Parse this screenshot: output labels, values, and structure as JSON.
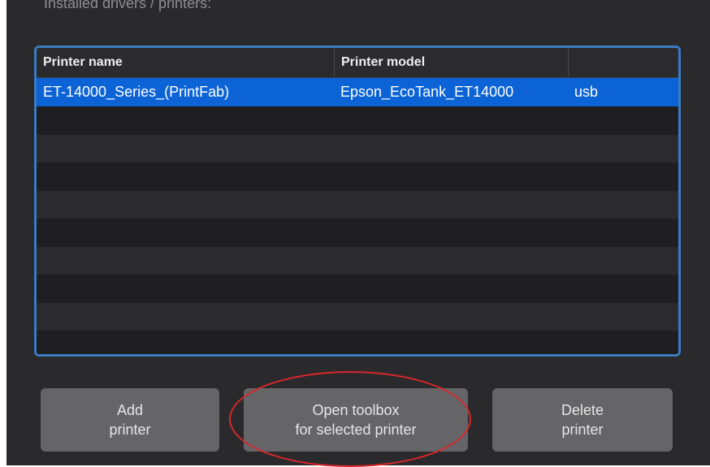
{
  "header": {
    "partial_text": "Installed drivers / printers:"
  },
  "table": {
    "columns": [
      "Printer name",
      "Printer model",
      ""
    ],
    "rows": [
      {
        "name": "ET-14000_Series_(PrintFab)",
        "model": "Epson_EcoTank_ET14000",
        "connection": "usb",
        "selected": true
      }
    ],
    "empty_row_count": 9
  },
  "buttons": {
    "add": "Add\nprinter",
    "toolbox": "Open toolbox\nfor selected printer",
    "delete": "Delete\nprinter"
  },
  "colors": {
    "selection": "#0b63d6",
    "table_border": "#3a7bc0",
    "annotation": "#d9262b",
    "window_bg": "#2a2a2c"
  }
}
